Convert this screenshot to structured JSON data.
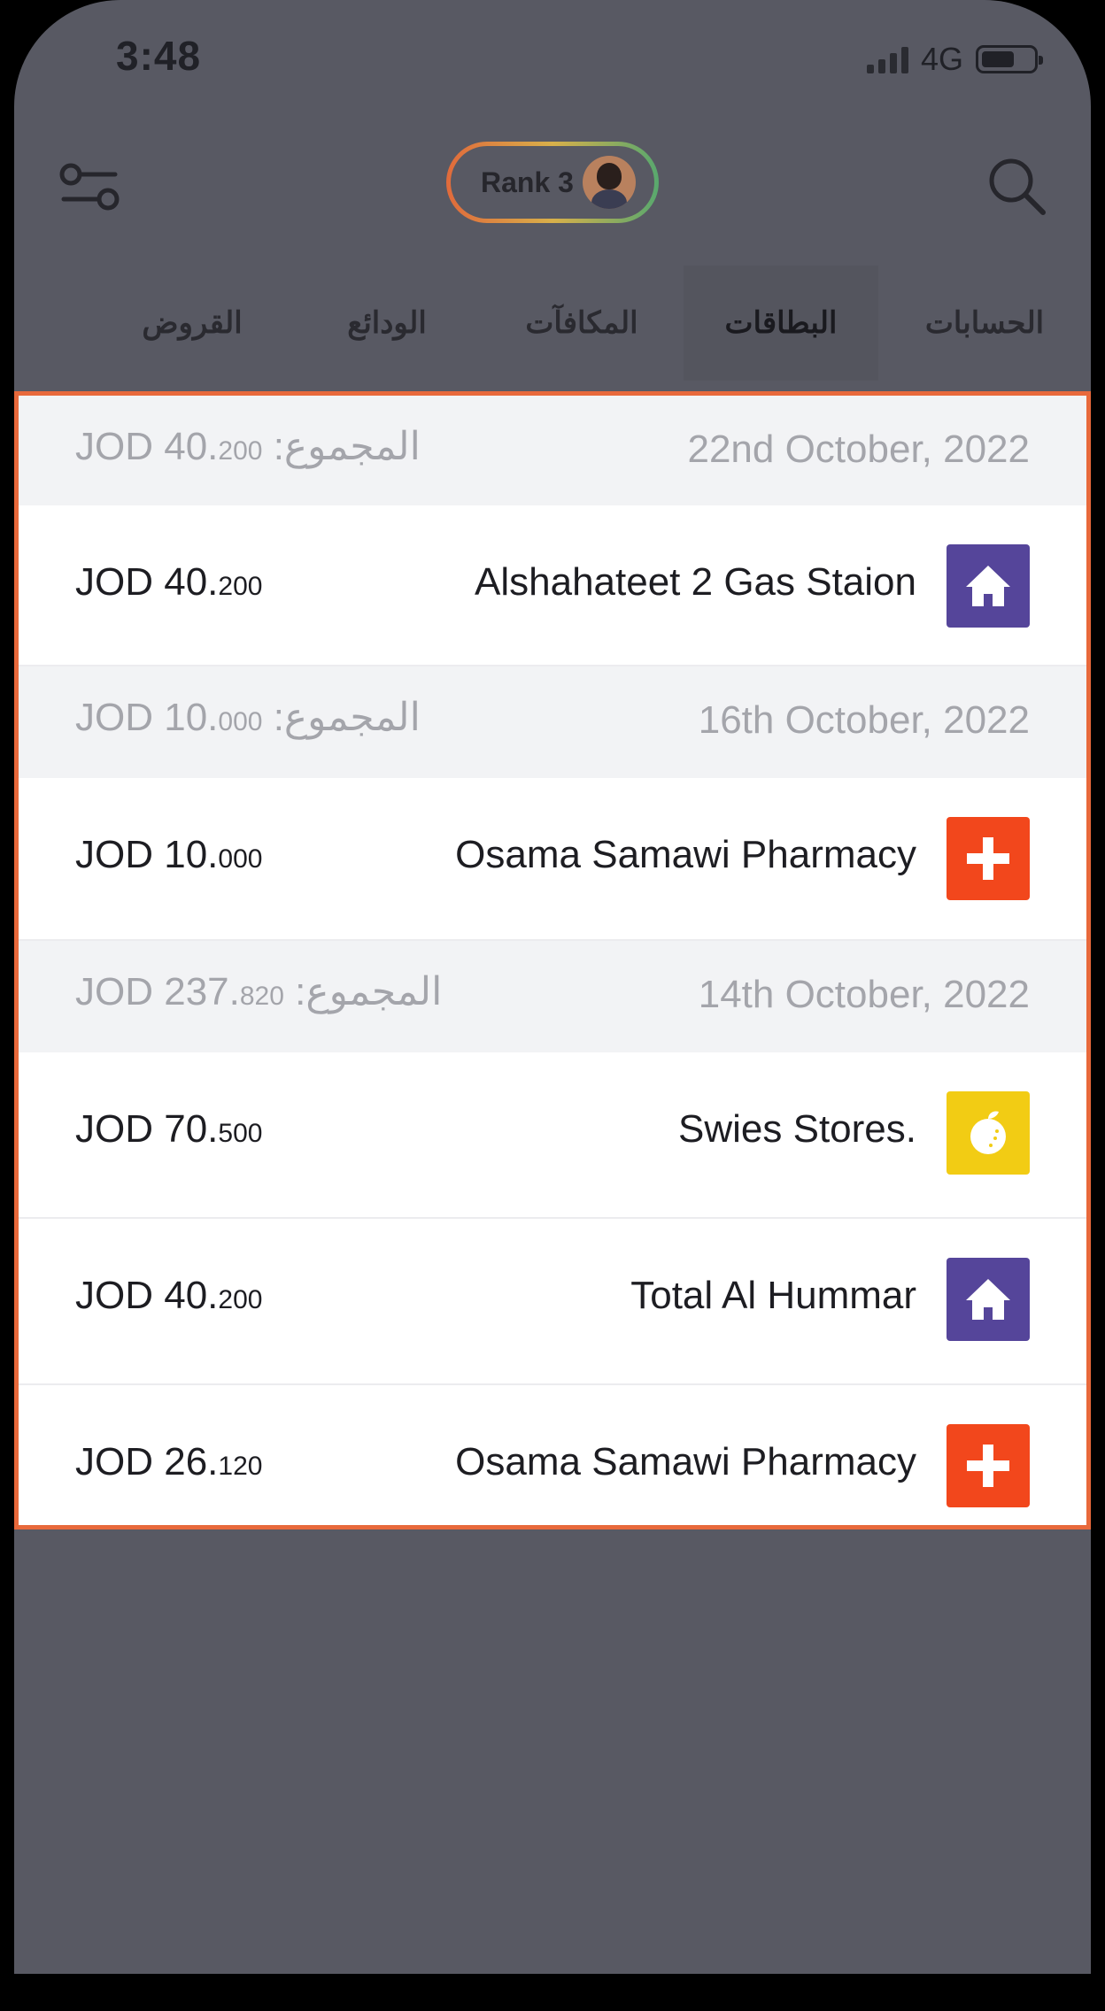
{
  "status": {
    "time": "3:48",
    "network": "4G"
  },
  "header": {
    "rank_label": "Rank 3"
  },
  "tabs": [
    {
      "label": "الحسابات",
      "active": false
    },
    {
      "label": "البطاقات",
      "active": true
    },
    {
      "label": "المكافآت",
      "active": false
    },
    {
      "label": "الودائع",
      "active": false
    },
    {
      "label": "القروض",
      "active": false
    }
  ],
  "transactions": [
    {
      "date": "22nd October, 2022",
      "total_label": "المجموع:",
      "total_main": "JOD 40.",
      "total_decimals": "200",
      "items": [
        {
          "merchant": "Alshahateet 2 Gas Staion",
          "amount_main": "JOD 40.",
          "amount_decimals": "200",
          "category_icon": "home-icon"
        }
      ]
    },
    {
      "date": "16th October, 2022",
      "total_label": "المجموع:",
      "total_main": "JOD 10.",
      "total_decimals": "000",
      "items": [
        {
          "merchant": "Osama Samawi Pharmacy",
          "amount_main": "JOD 10.",
          "amount_decimals": "000",
          "category_icon": "plus-icon"
        }
      ]
    },
    {
      "date": "14th October, 2022",
      "total_label": "المجموع:",
      "total_main": "JOD 237.",
      "total_decimals": "820",
      "items": [
        {
          "merchant": "Swies Stores.",
          "amount_main": "JOD 70.",
          "amount_decimals": "500",
          "category_icon": "lemon-icon"
        },
        {
          "merchant": "Total Al Hummar",
          "amount_main": "JOD 40.",
          "amount_decimals": "200",
          "category_icon": "home-icon"
        },
        {
          "merchant": "Osama Samawi Pharmacy",
          "amount_main": "JOD 26.",
          "amount_decimals": "120",
          "category_icon": "plus-icon"
        }
      ]
    }
  ],
  "colors": {
    "overlay_bg": "#585963",
    "highlight_border": "#e8693b",
    "home_category": "#55459a",
    "health_category": "#f2471c",
    "grocery_category": "#f2cc14"
  }
}
